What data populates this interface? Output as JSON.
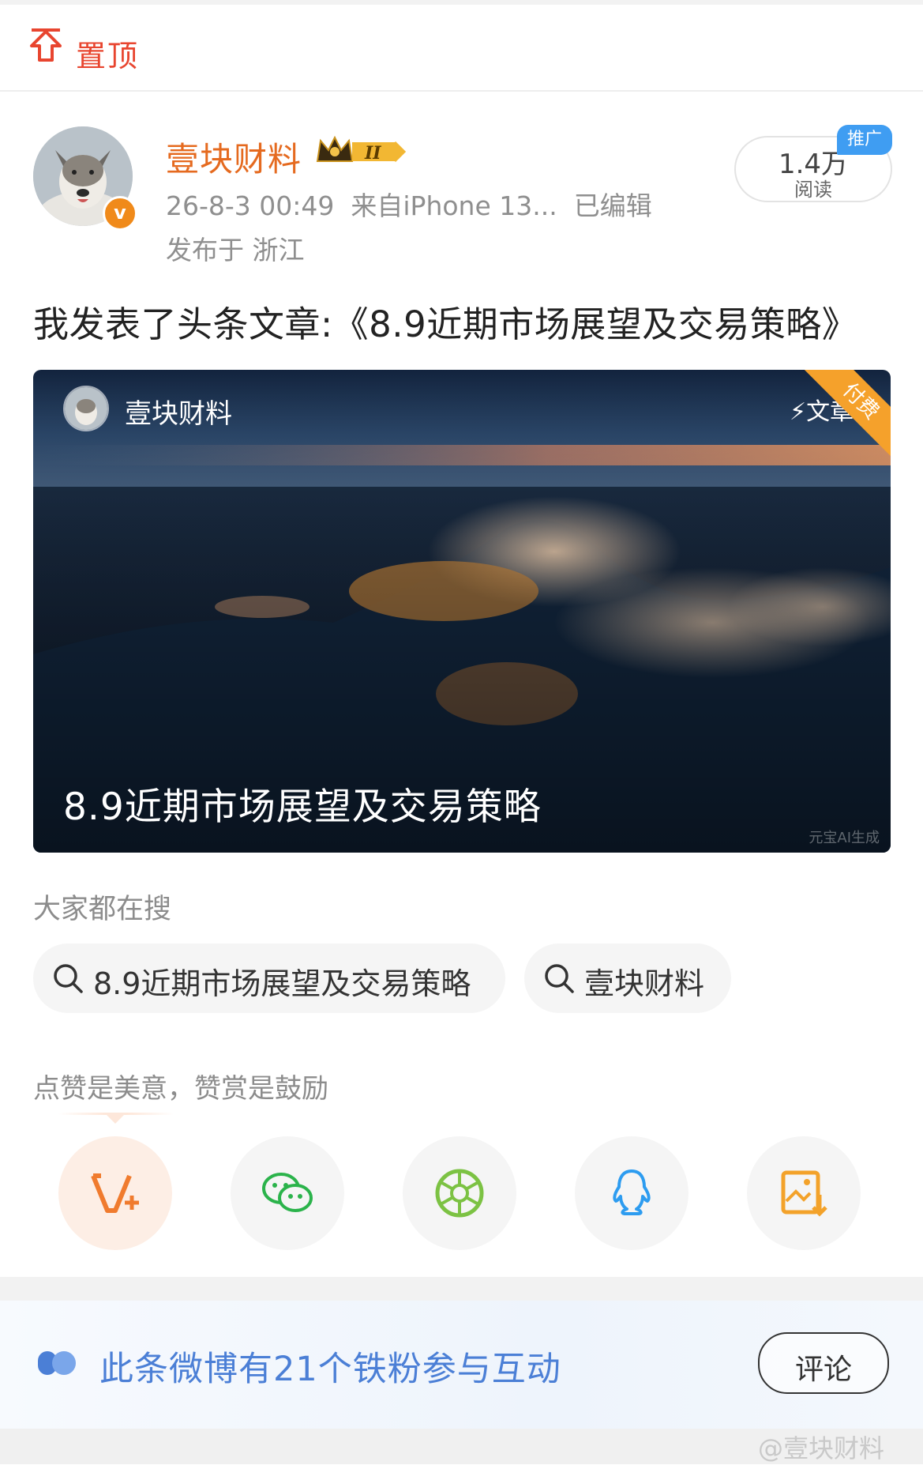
{
  "pin": {
    "label": "置顶"
  },
  "post": {
    "author": "壹块财料",
    "timestamp": "26-8-3 00:49",
    "source": "来自iPhone 13...",
    "edited": "已编辑",
    "location": "发布于 浙江",
    "reads_count": "1.4万",
    "reads_label": "阅读",
    "promo_badge": "推广",
    "text": "我发表了头条文章:《8.9近期市场展望及交易策略》"
  },
  "article_card": {
    "author": "壹块财料",
    "type_label": "文章",
    "paid_ribbon": "付费",
    "title": "8.9近期市场展望及交易策略",
    "ai_mark": "元宝AI生成"
  },
  "search": {
    "heading": "大家都在搜",
    "chips": [
      "8.9近期市场展望及交易策略",
      "壹块财料"
    ]
  },
  "like_hint": "点赞是美意，赞赏是鼓励",
  "share": {
    "buttons": [
      "v-plus-icon",
      "wechat-icon",
      "moments-icon",
      "qq-icon",
      "save-image-icon"
    ]
  },
  "fans_bar": {
    "text": "此条微博有21个铁粉参与互动",
    "comment_label": "评论"
  },
  "watermark": "@壹块财料",
  "colors": {
    "accent_orange": "#e56a1f",
    "pin_red": "#e8452f",
    "link_blue": "#4b7fd6",
    "promo_blue": "#3f9df2"
  }
}
